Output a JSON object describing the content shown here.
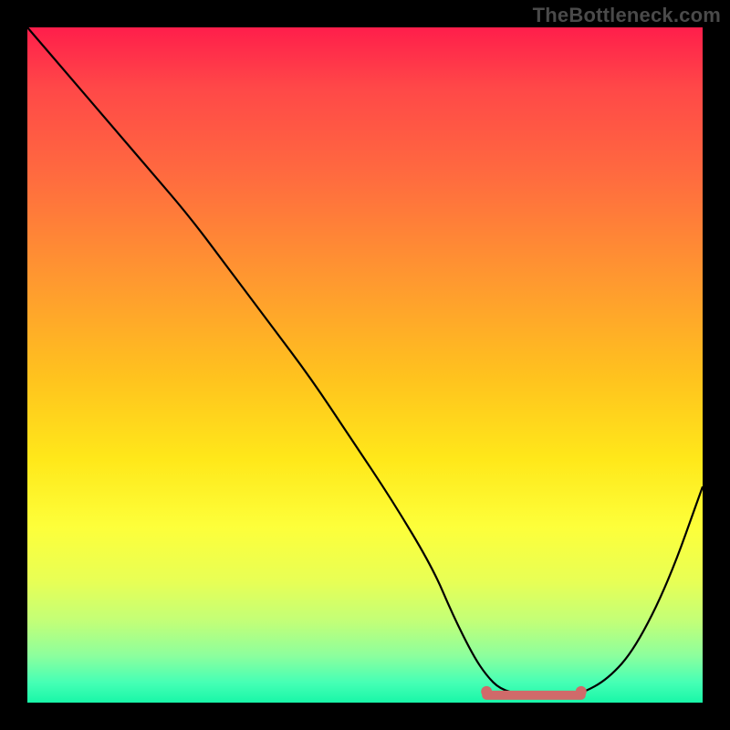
{
  "watermark": "TheBottleneck.com",
  "colors": {
    "frame_bg": "#000000",
    "curve_stroke": "#000000",
    "optimal_marker": "#d06a6a",
    "gradient_top": "#ff1e4b",
    "gradient_bottom": "#18f7a8"
  },
  "chart_data": {
    "type": "line",
    "title": "",
    "xlabel": "",
    "ylabel": "",
    "xlim": [
      0,
      100
    ],
    "ylim": [
      0,
      100
    ],
    "grid": false,
    "legend": false,
    "series": [
      {
        "name": "bottleneck-curve",
        "x": [
          0,
          6,
          12,
          18,
          24,
          30,
          36,
          42,
          48,
          54,
          60,
          63,
          66,
          68,
          70,
          73,
          76,
          79,
          82,
          86,
          90,
          95,
          100
        ],
        "y": [
          100,
          93,
          86,
          79,
          72,
          64,
          56,
          48,
          39,
          30,
          20,
          13,
          7,
          4,
          2,
          1.2,
          1.0,
          1.0,
          1.3,
          3.5,
          8,
          18,
          32
        ]
      }
    ],
    "optimal_zone": {
      "x_start": 68,
      "x_end": 82,
      "y_level": 1.1
    },
    "annotations": [
      {
        "text": "TheBottleneck.com",
        "role": "watermark",
        "position": "top-right"
      }
    ]
  }
}
